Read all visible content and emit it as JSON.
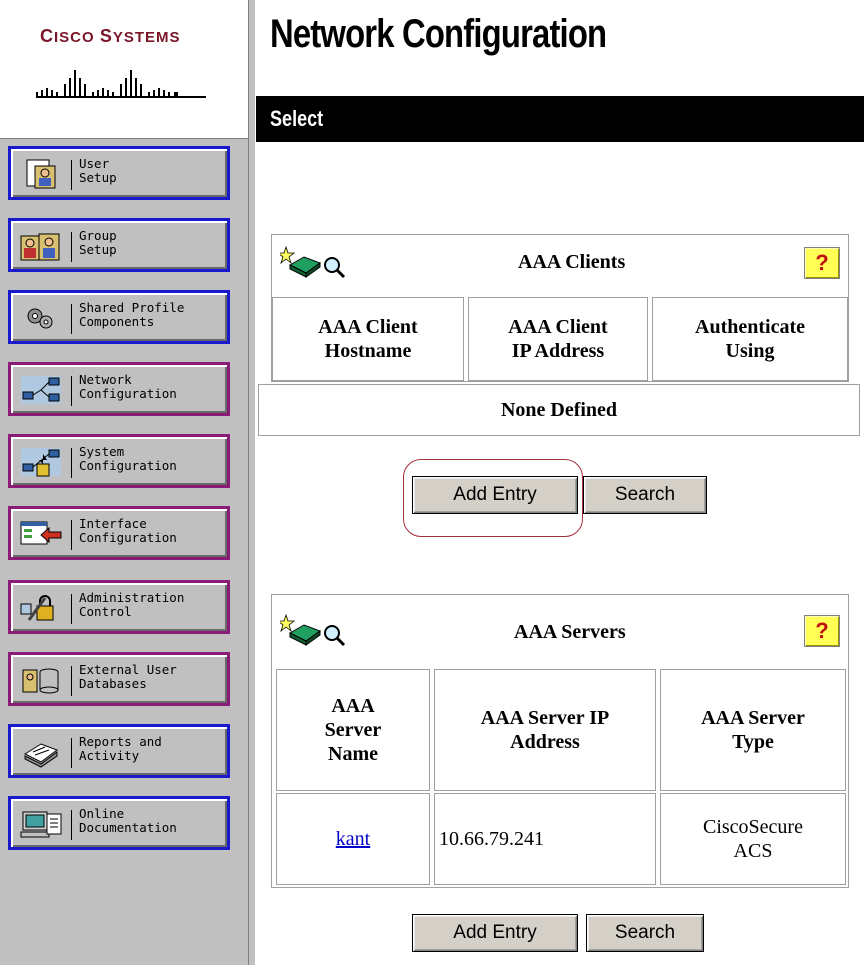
{
  "logo": {
    "brand_text": "Cisco Systems"
  },
  "page_title": "Network Configuration",
  "section_bar": "Select",
  "nav": [
    {
      "line1": "User",
      "line2": "Setup",
      "icon": "user-setup-icon"
    },
    {
      "line1": "Group",
      "line2": "Setup",
      "icon": "group-setup-icon"
    },
    {
      "line1": "Shared Profile",
      "line2": "Components",
      "icon": "shared-profile-icon"
    },
    {
      "line1": "Network",
      "line2": "Configuration",
      "icon": "network-config-icon"
    },
    {
      "line1": "System",
      "line2": "Configuration",
      "icon": "system-config-icon"
    },
    {
      "line1": "Interface",
      "line2": "Configuration",
      "icon": "interface-config-icon"
    },
    {
      "line1": "Administration",
      "line2": "Control",
      "icon": "administration-icon"
    },
    {
      "line1": "External User",
      "line2": "Databases",
      "icon": "database-icon"
    },
    {
      "line1": "Reports and",
      "line2": "Activity",
      "icon": "reports-icon"
    },
    {
      "line1": "Online",
      "line2": "Documentation",
      "icon": "documentation-icon"
    }
  ],
  "aaa_clients": {
    "title": "AAA Clients",
    "help": "?",
    "columns": [
      {
        "line1": "AAA Client",
        "line2": "Hostname"
      },
      {
        "line1": "AAA Client",
        "line2": "IP Address"
      },
      {
        "line1": "Authenticate",
        "line2": "Using"
      }
    ],
    "empty_text": "None Defined",
    "add_label": "Add Entry",
    "search_label": "Search"
  },
  "aaa_servers": {
    "title": "AAA Servers",
    "help": "?",
    "columns": [
      {
        "line1": "AAA",
        "line2": "Server",
        "line3": "Name"
      },
      {
        "line1": "AAA Server IP",
        "line2": "Address"
      },
      {
        "line1": "AAA Server",
        "line2": "Type"
      }
    ],
    "rows": [
      {
        "name": "kant",
        "ip": "10.66.79.241",
        "type_line1": "CiscoSecure",
        "type_line2": "ACS"
      }
    ],
    "add_label": "Add Entry",
    "search_label": "Search"
  },
  "colors": {
    "nav_border_blue": "#1a1acc",
    "nav_border_purple": "#8a1c78",
    "logo": "#7a1628",
    "link": "#0000cc"
  }
}
